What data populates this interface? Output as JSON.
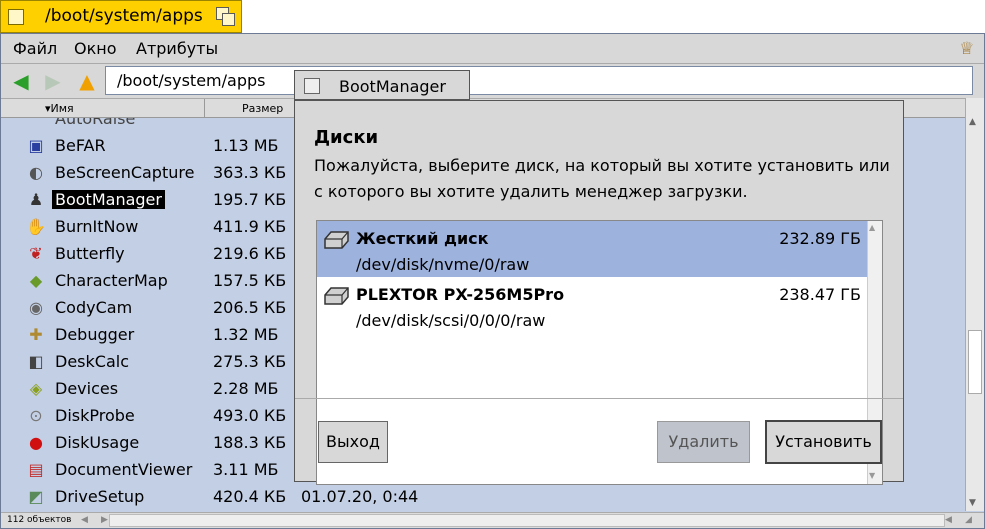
{
  "tracker": {
    "title": "/boot/system/apps",
    "menu": [
      "Файл",
      "Окно",
      "Атрибуты"
    ],
    "path": "/boot/system/apps",
    "columns": {
      "name": "Имя",
      "size": "Размер"
    },
    "status": "112 объектов",
    "files": [
      {
        "name": "BeFAR",
        "size": "1.13 МБ",
        "icon": "befar-icon",
        "glyph": "▣",
        "color": "#2a3fa0"
      },
      {
        "name": "BeScreenCapture",
        "size": "363.3 КБ",
        "icon": "camera-icon",
        "glyph": "◐",
        "color": "#555"
      },
      {
        "name": "BootManager",
        "size": "195.7 КБ",
        "icon": "boot-icon",
        "glyph": "♟",
        "color": "#333",
        "selected": true
      },
      {
        "name": "BurnItNow",
        "size": "411.9 КБ",
        "icon": "burn-icon",
        "glyph": "✋",
        "color": "#a08040"
      },
      {
        "name": "Butterfly",
        "size": "219.6 КБ",
        "icon": "butterfly-icon",
        "glyph": "❦",
        "color": "#c02020"
      },
      {
        "name": "CharacterMap",
        "size": "157.5 КБ",
        "icon": "charmap-icon",
        "glyph": "◆",
        "color": "#6a9a2a"
      },
      {
        "name": "CodyCam",
        "size": "206.5 КБ",
        "icon": "webcam-icon",
        "glyph": "◉",
        "color": "#666"
      },
      {
        "name": "Debugger",
        "size": "1.32 МБ",
        "icon": "debugger-icon",
        "glyph": "✚",
        "color": "#b08a30"
      },
      {
        "name": "DeskCalc",
        "size": "275.3 КБ",
        "icon": "calculator-icon",
        "glyph": "◧",
        "color": "#444"
      },
      {
        "name": "Devices",
        "size": "2.28 МБ",
        "icon": "devices-icon",
        "glyph": "◈",
        "color": "#8aa020"
      },
      {
        "name": "DiskProbe",
        "size": "493.0 КБ",
        "icon": "diskprobe-icon",
        "glyph": "⊙",
        "color": "#777"
      },
      {
        "name": "DiskUsage",
        "size": "188.3 КБ",
        "icon": "diskusage-icon",
        "glyph": "●",
        "color": "#d01010"
      },
      {
        "name": "DocumentViewer",
        "size": "3.11 МБ",
        "icon": "document-icon",
        "glyph": "▤",
        "color": "#c03030"
      },
      {
        "name": "DriveSetup",
        "size": "420.4 КБ",
        "icon": "drivesetup-icon",
        "glyph": "◩",
        "color": "#5a8a5a",
        "date": "01.07.20, 0:44"
      }
    ]
  },
  "dialog": {
    "title": "BootManager",
    "heading": "Диски",
    "description": "Пожалуйста, выберите диск, на который вы хотите установить или с которого вы хотите удалить менеджер загрузки.",
    "disks": [
      {
        "name": "Жесткий диск",
        "size": "232.89 ГБ",
        "path": "/dev/disk/nvme/0/raw",
        "selected": true
      },
      {
        "name": "PLEXTOR PX-256M5Pro",
        "size": "238.47 ГБ",
        "path": "/dev/disk/scsi/0/0/0/raw"
      }
    ],
    "buttons": {
      "quit": "Выход",
      "remove": "Удалить",
      "install": "Установить"
    }
  }
}
